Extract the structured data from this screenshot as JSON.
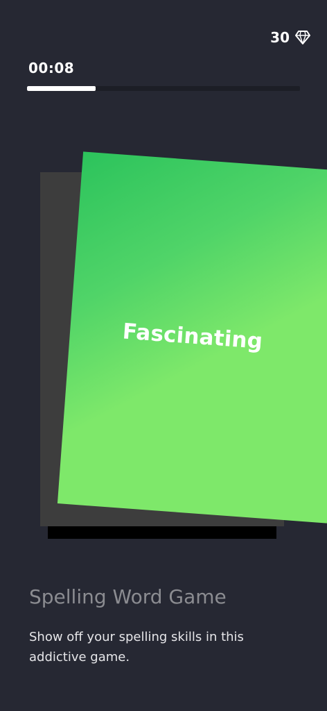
{
  "header": {
    "gems": "30",
    "gem_icon": "diamond-icon",
    "timer": "00:08",
    "progress": 0.25
  },
  "card": {
    "word": "Fascinating"
  },
  "info": {
    "title": "Spelling Word Game",
    "description": "Show off your spelling skills in this addictive game."
  },
  "colors": {
    "background": "#262833",
    "card_green": "#7ee86a",
    "card_green_dark": "#2cc35c",
    "card_back": "#3d3d3d",
    "progress_fill": "#ffffff"
  }
}
